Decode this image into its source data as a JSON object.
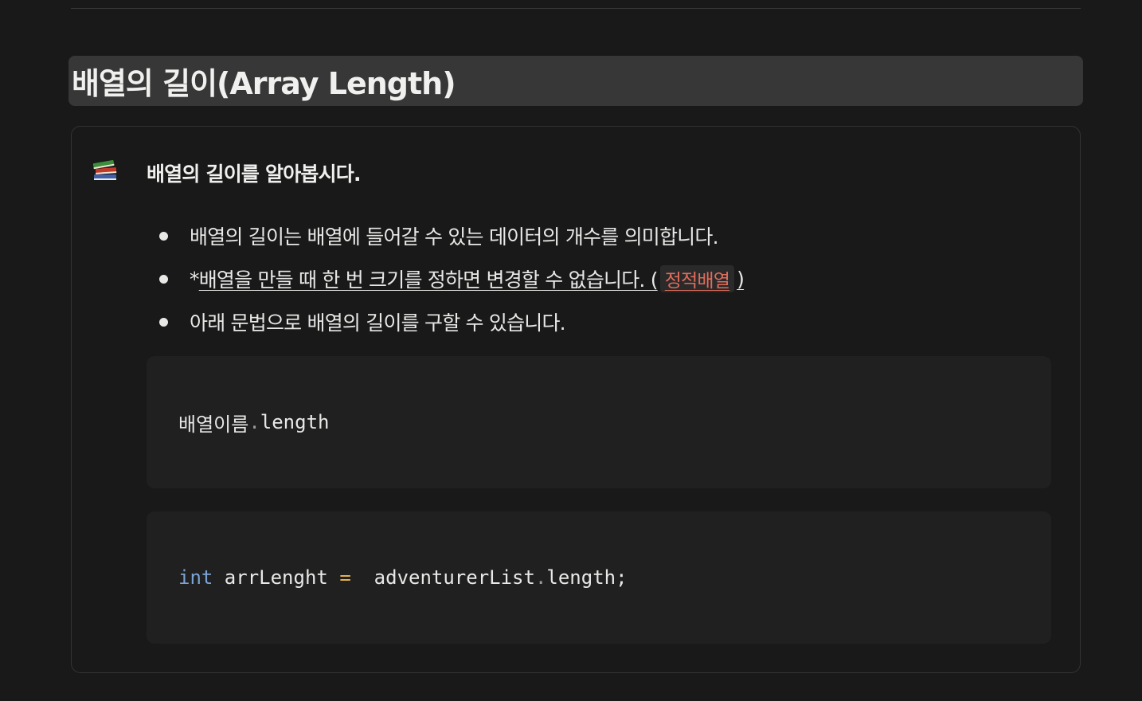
{
  "heading": {
    "title": "배열의 길이(Array Length)"
  },
  "callout": {
    "icon": "books-icon",
    "title": "배열의 길이를 알아봅시다.",
    "bullets": {
      "first": "배열의 길이는 배열에 들어갈 수 있는 데이터의 개수를 의미합니다.",
      "second_prefix": "*",
      "second_underlined": "배열을 만들 때 한 번 크기를 정하면 변경할 수 없습니다. (",
      "second_code": "정적배열",
      "second_suffix": ")",
      "third": "아래 문법으로 배열의 길이를 구할 수 있습니다."
    }
  },
  "code_blocks": {
    "syntax": {
      "name": "배열이름",
      "dot": ".",
      "prop": "length"
    },
    "example": {
      "keyword": "int",
      "variable": " arrLenght ",
      "operator": "=",
      "object": "  adventurerList",
      "dot": ".",
      "prop": "length;"
    }
  },
  "colors": {
    "background": "#191919",
    "heading_bg": "#373737",
    "code_bg": "#202020",
    "inline_code_text": "#e06c5c",
    "keyword": "#7aa3d4",
    "operator": "#e5b24b"
  }
}
